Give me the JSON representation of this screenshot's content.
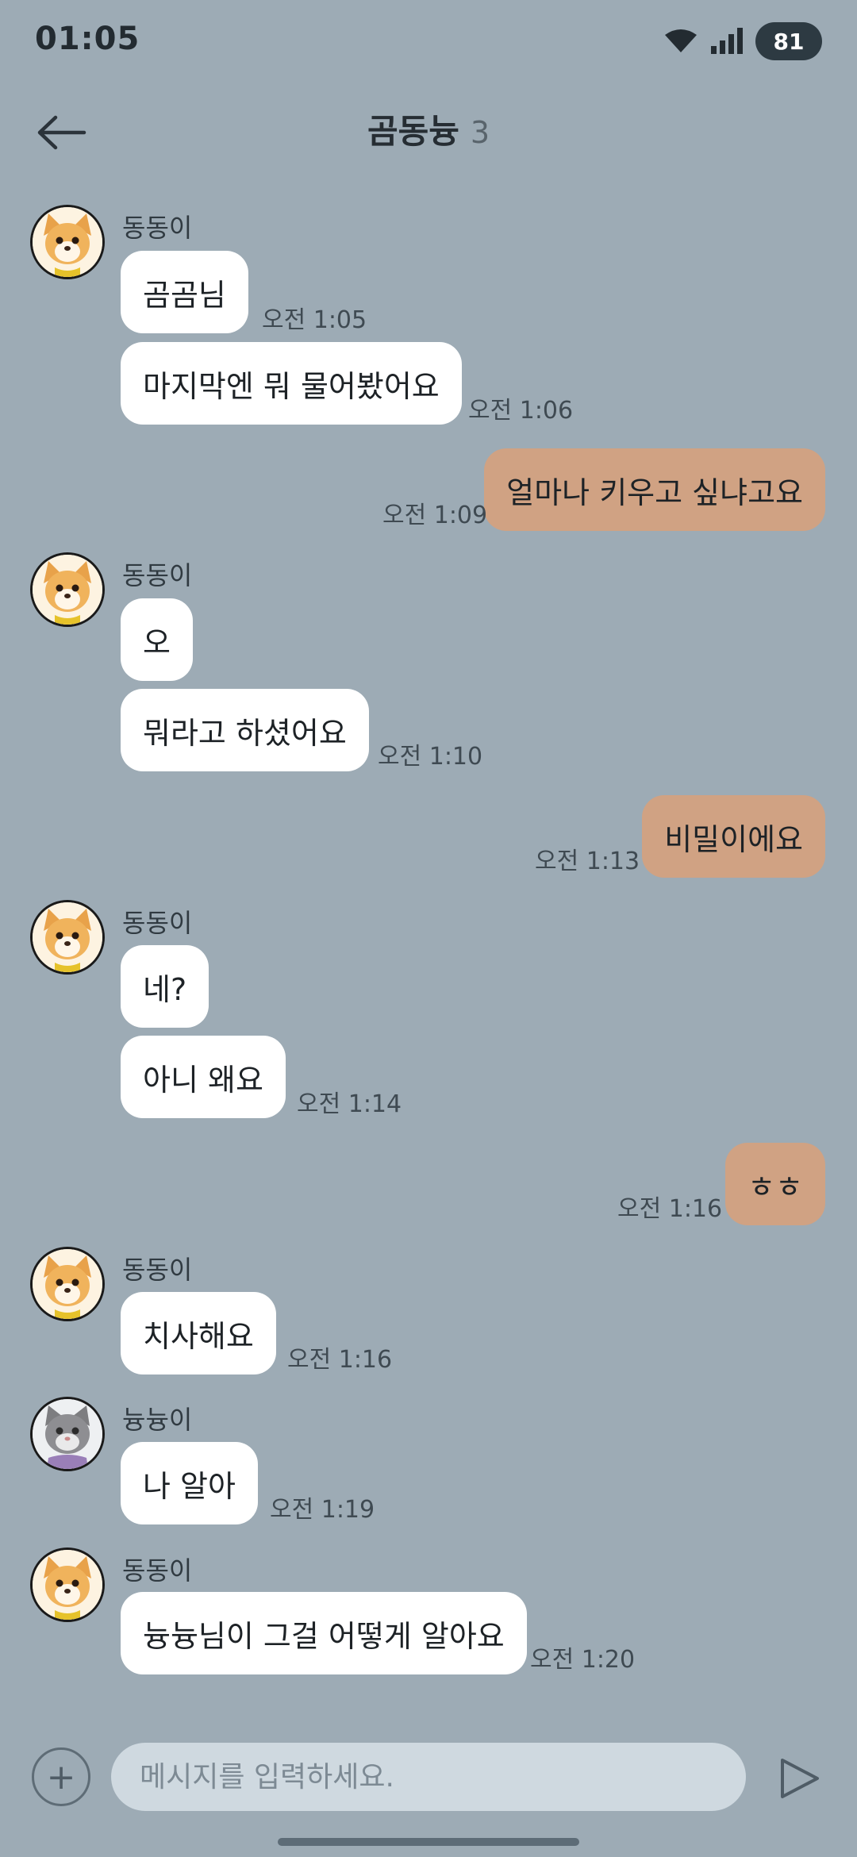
{
  "status": {
    "time": "01:05",
    "battery": "81"
  },
  "header": {
    "title": "곰동늉",
    "member_count": "3"
  },
  "messages": [
    {
      "sender": "동동이",
      "avatar": "dog-avatar",
      "text": "곰곰님",
      "time": "오전 1:05"
    },
    {
      "sender": "",
      "text": "마지막엔 뭐 물어봤어요",
      "time": "오전 1:06"
    },
    {
      "sender": "me",
      "text": "얼마나 키우고 싶냐고요",
      "time": "오전 1:09"
    },
    {
      "sender": "동동이",
      "avatar": "dog-avatar",
      "text": "오",
      "time": ""
    },
    {
      "sender": "",
      "text": "뭐라고 하셨어요",
      "time": "오전 1:10"
    },
    {
      "sender": "me",
      "text": "비밀이에요",
      "time": "오전 1:13"
    },
    {
      "sender": "동동이",
      "avatar": "dog-avatar",
      "text": "네?",
      "time": ""
    },
    {
      "sender": "",
      "text": "아니 왜요",
      "time": "오전 1:14"
    },
    {
      "sender": "me",
      "text": "ㅎㅎ",
      "time": "오전 1:16"
    },
    {
      "sender": "동동이",
      "avatar": "dog-avatar",
      "text": "치사해요",
      "time": "오전 1:16"
    },
    {
      "sender": "늉늉이",
      "avatar": "cat-avatar",
      "text": "나 알아",
      "time": "오전 1:19"
    },
    {
      "sender": "동동이",
      "avatar": "dog-avatar",
      "text": "늉늉님이 그걸 어떻게 알아요",
      "time": "오전 1:20"
    }
  ],
  "input": {
    "placeholder": "메시지를 입력하세요."
  },
  "colors": {
    "background": "#9dabb5",
    "my_bubble": "#d0a283",
    "their_bubble": "#ffffff"
  }
}
